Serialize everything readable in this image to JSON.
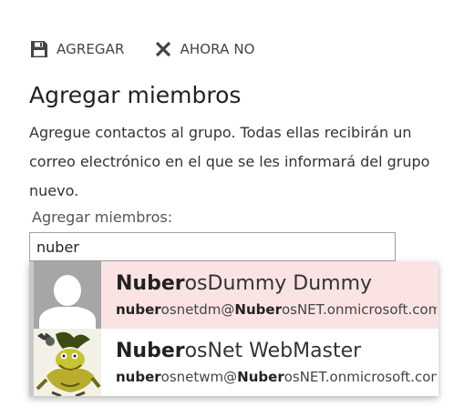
{
  "toolbar": {
    "add_label": "AGREGAR",
    "cancel_label": "AHORA NO"
  },
  "title": "Agregar miembros",
  "description": "Agregue contactos al grupo. Todas ellas recibirán un correo electrónico en el que se les informará del grupo nuevo.",
  "field": {
    "label": "Agregar miembros:",
    "value": "nuber"
  },
  "suggestions": [
    {
      "name_match": "Nuber",
      "name_rest": "osDummy Dummy",
      "email_match1": "nuber",
      "email_mid": "osnetdm@",
      "email_match2": "Nuber",
      "email_rest": "osNET.onmicrosoft.com",
      "avatar": "default-person-icon"
    },
    {
      "name_match": "Nuber",
      "name_rest": "osNet WebMaster",
      "email_match1": "nuber",
      "email_mid": "osnetwm@",
      "email_match2": "Nuber",
      "email_rest": "osNET.onmicrosoft.com",
      "avatar": "cartoon-character-photo"
    }
  ],
  "colors": {
    "highlight": "#fbe3e4",
    "placeholder_avatar": "#a6a6a6"
  }
}
